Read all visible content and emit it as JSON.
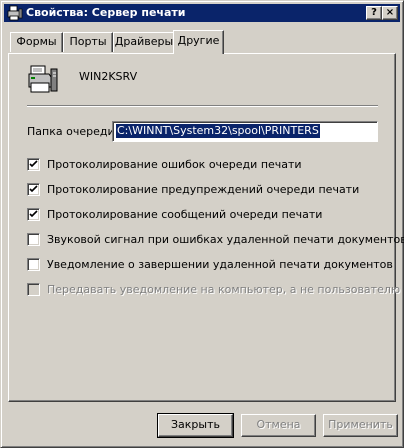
{
  "window": {
    "title": "Свойства: Сервер печати",
    "help_btn": "?",
    "close_btn": "×"
  },
  "tabs": [
    {
      "label": "Формы"
    },
    {
      "label": "Порты"
    },
    {
      "label": "Драйверы"
    },
    {
      "label": "Другие"
    }
  ],
  "active_tab": "Другие",
  "server": {
    "name": "WIN2KSRV"
  },
  "spool": {
    "label": "Папка очереди:",
    "value": "C:\\WINNT\\System32\\spool\\PRINTERS"
  },
  "options": [
    {
      "label": "Протоколирование ошибок очереди печати",
      "checked": true,
      "enabled": true
    },
    {
      "label": "Протоколирование предупреждений очереди печати",
      "checked": true,
      "enabled": true
    },
    {
      "label": "Протоколирование сообщений очереди печати",
      "checked": true,
      "enabled": true
    },
    {
      "label": "Звуковой сигнал при ошибках удаленной печати документов",
      "checked": false,
      "enabled": true
    },
    {
      "label": "Уведомление о завершении удаленной печати документов",
      "checked": false,
      "enabled": true
    },
    {
      "label": "Передавать уведомление на компьютер, а не пользователю",
      "checked": false,
      "enabled": false
    }
  ],
  "buttons": {
    "close": "Закрыть",
    "cancel": "Отмена",
    "apply": "Применить"
  },
  "colors": {
    "titlebar": "#0a246a",
    "face": "#d4d0c8",
    "selection": "#0a246a"
  }
}
